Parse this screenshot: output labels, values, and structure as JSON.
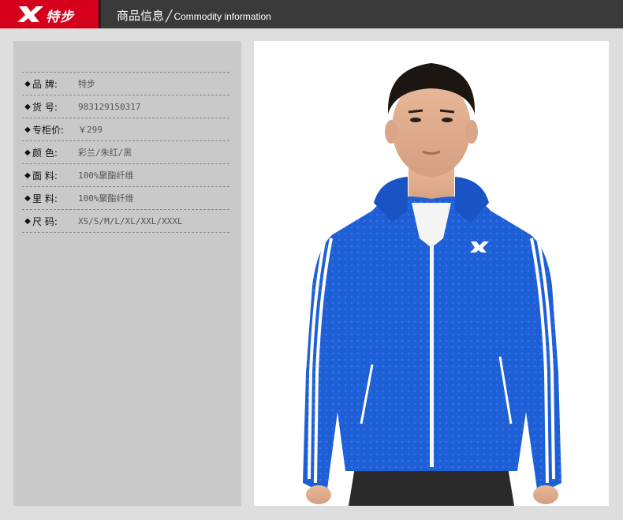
{
  "header": {
    "brand_text": "特步",
    "title_cn": "商品信息",
    "separator": "╱",
    "title_en": "Commodity information"
  },
  "info": {
    "bullet": "◆",
    "rows": [
      {
        "label": "品  牌:",
        "value": "特步"
      },
      {
        "label": "货  号:",
        "value": "983129150317"
      },
      {
        "label": "专柜价:",
        "value": "￥299"
      },
      {
        "label": "颜  色:",
        "value": "彩兰/朱红/黑"
      },
      {
        "label": "面  料:",
        "value": "100%聚酯纤维"
      },
      {
        "label": "里  料:",
        "value": "100%聚酯纤维"
      },
      {
        "label": "尺  码:",
        "value": "XS/S/M/L/XL/XXL/XXXL"
      }
    ]
  },
  "colors": {
    "brand_red": "#d5001c",
    "header_bg": "#3a3a3a",
    "panel_bg": "#c9c9c9",
    "page_bg": "#dedede",
    "jacket_blue": "#1f5fd6"
  },
  "photo": {
    "icon": "product-photo"
  }
}
